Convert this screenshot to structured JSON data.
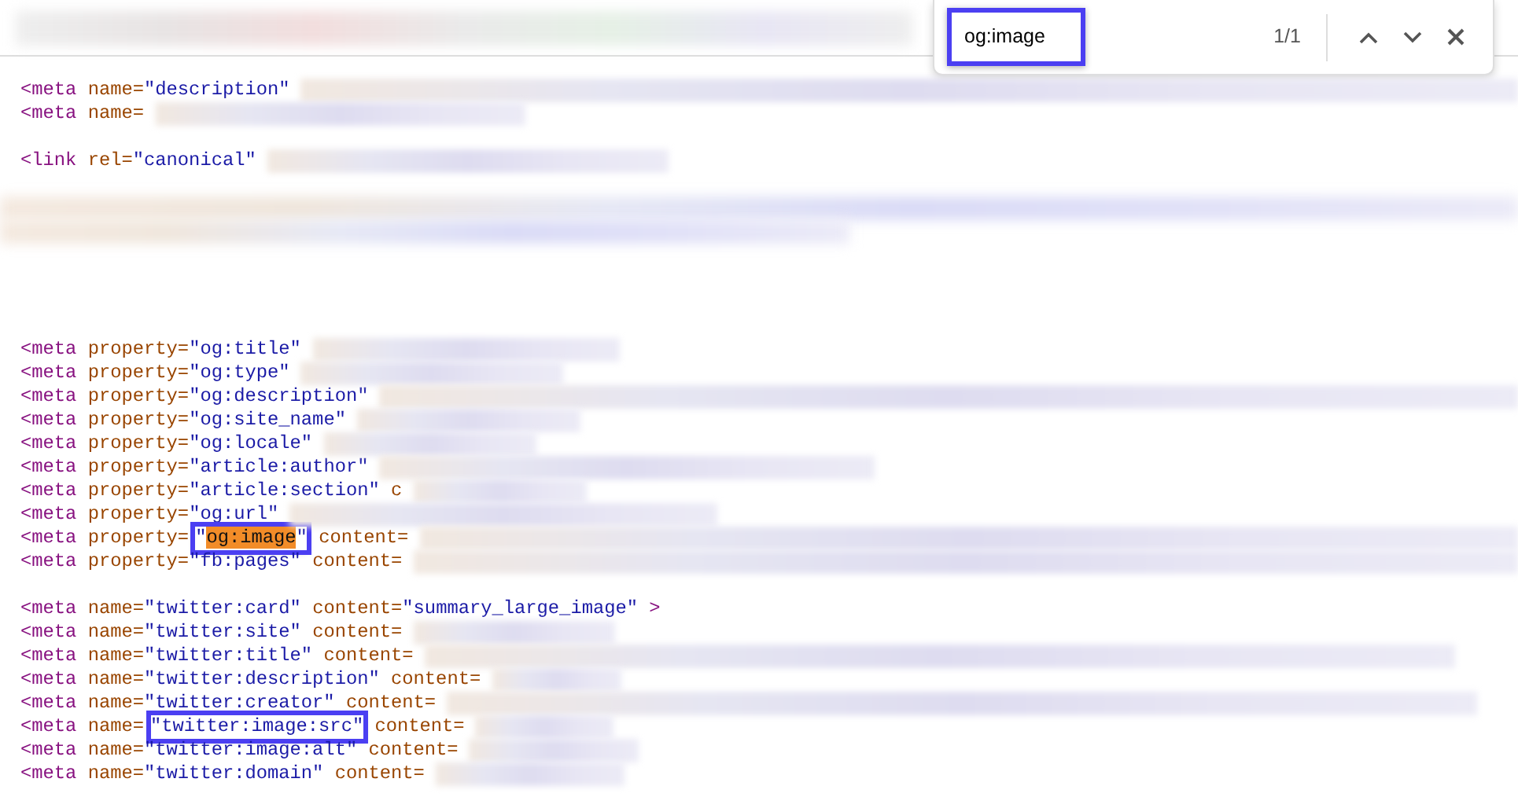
{
  "find_bar": {
    "query": "og:image",
    "outlined": true,
    "count": "1/1"
  },
  "lines": [
    {
      "kind": "code",
      "redacted": true,
      "tokens": [
        {
          "kind": "tag",
          "text": "<meta"
        },
        {
          "kind": "attr",
          "text": "name="
        },
        {
          "kind": "value",
          "text": "\"description\""
        }
      ]
    },
    {
      "kind": "code",
      "redacted": true,
      "tokens": [
        {
          "kind": "tag",
          "text": "<meta"
        },
        {
          "kind": "attr",
          "text": "name="
        }
      ]
    },
    {
      "kind": "blank"
    },
    {
      "kind": "code",
      "redacted": true,
      "tokens": [
        {
          "kind": "tag",
          "text": "<link"
        },
        {
          "kind": "attr",
          "text": "rel="
        },
        {
          "kind": "value",
          "text": "\"canonical\""
        }
      ]
    },
    {
      "kind": "blank"
    },
    {
      "kind": "redacted"
    },
    {
      "kind": "redacted"
    },
    {
      "kind": "blank"
    },
    {
      "kind": "blank"
    },
    {
      "kind": "blank"
    },
    {
      "kind": "blank"
    },
    {
      "kind": "code",
      "redacted": true,
      "tokens": [
        {
          "kind": "tag",
          "text": "<meta"
        },
        {
          "kind": "attr",
          "text": "property="
        },
        {
          "kind": "value",
          "text": "\"og:title\""
        }
      ]
    },
    {
      "kind": "code",
      "redacted": true,
      "tokens": [
        {
          "kind": "tag",
          "text": "<meta"
        },
        {
          "kind": "attr",
          "text": "property="
        },
        {
          "kind": "value",
          "text": "\"og:type\""
        }
      ]
    },
    {
      "kind": "code",
      "redacted": true,
      "tokens": [
        {
          "kind": "tag",
          "text": "<meta"
        },
        {
          "kind": "attr",
          "text": "property="
        },
        {
          "kind": "value",
          "text": "\"og:description\""
        }
      ]
    },
    {
      "kind": "code",
      "redacted": true,
      "tokens": [
        {
          "kind": "tag",
          "text": "<meta"
        },
        {
          "kind": "attr",
          "text": "property="
        },
        {
          "kind": "value",
          "text": "\"og:site_name\""
        }
      ]
    },
    {
      "kind": "code",
      "redacted": true,
      "tokens": [
        {
          "kind": "tag",
          "text": "<meta"
        },
        {
          "kind": "attr",
          "text": "property="
        },
        {
          "kind": "value",
          "text": "\"og:locale\""
        }
      ]
    },
    {
      "kind": "code",
      "redacted": true,
      "tokens": [
        {
          "kind": "tag",
          "text": "<meta"
        },
        {
          "kind": "attr",
          "text": "property="
        },
        {
          "kind": "value",
          "text": "\"article:author\""
        }
      ]
    },
    {
      "kind": "code",
      "redacted": true,
      "tokens": [
        {
          "kind": "tag",
          "text": "<meta"
        },
        {
          "kind": "attr",
          "text": "property="
        },
        {
          "kind": "value",
          "text": "\"article:section\""
        },
        {
          "kind": "attr",
          "text": "c"
        }
      ]
    },
    {
      "kind": "code",
      "redacted": true,
      "tokens": [
        {
          "kind": "tag",
          "text": "<meta"
        },
        {
          "kind": "attr",
          "text": "property="
        },
        {
          "kind": "value",
          "text": "\"og:url\""
        }
      ]
    },
    {
      "kind": "code",
      "redacted": true,
      "tokens": [
        {
          "kind": "tag",
          "text": "<meta"
        },
        {
          "kind": "attr",
          "text": "property="
        },
        {
          "kind": "value",
          "outlined": true,
          "parts": [
            {
              "text": "\"",
              "highlighted": false
            },
            {
              "text": "og:image",
              "highlighted": true
            },
            {
              "text": "\"",
              "highlighted": false
            }
          ]
        },
        {
          "kind": "attr",
          "text": "content="
        }
      ]
    },
    {
      "kind": "code",
      "redacted": true,
      "tokens": [
        {
          "kind": "tag",
          "text": "<meta"
        },
        {
          "kind": "attr",
          "text": "property="
        },
        {
          "kind": "value",
          "text": "\"fb:pages\""
        },
        {
          "kind": "attr",
          "text": "content="
        }
      ]
    },
    {
      "kind": "blank"
    },
    {
      "kind": "code",
      "redacted": false,
      "tokens": [
        {
          "kind": "tag",
          "text": "<meta"
        },
        {
          "kind": "attr",
          "text": "name="
        },
        {
          "kind": "value",
          "text": "\"twitter:card\""
        },
        {
          "kind": "attr",
          "text": "content="
        },
        {
          "kind": "value",
          "text": "\"summary_large_image\""
        },
        {
          "kind": "tag",
          "text": ">"
        }
      ]
    },
    {
      "kind": "code",
      "redacted": true,
      "tokens": [
        {
          "kind": "tag",
          "text": "<meta"
        },
        {
          "kind": "attr",
          "text": "name="
        },
        {
          "kind": "value",
          "text": "\"twitter:site\""
        },
        {
          "kind": "attr",
          "text": "content="
        }
      ]
    },
    {
      "kind": "code",
      "redacted": true,
      "tokens": [
        {
          "kind": "tag",
          "text": "<meta"
        },
        {
          "kind": "attr",
          "text": "name="
        },
        {
          "kind": "value",
          "text": "\"twitter:title\""
        },
        {
          "kind": "attr",
          "text": "content="
        }
      ]
    },
    {
      "kind": "code",
      "redacted": true,
      "tokens": [
        {
          "kind": "tag",
          "text": "<meta"
        },
        {
          "kind": "attr",
          "text": "name="
        },
        {
          "kind": "value",
          "text": "\"twitter:description\""
        },
        {
          "kind": "attr",
          "text": "content="
        }
      ]
    },
    {
      "kind": "code",
      "redacted": true,
      "tokens": [
        {
          "kind": "tag",
          "text": "<meta"
        },
        {
          "kind": "attr",
          "text": "name="
        },
        {
          "kind": "value",
          "text": "\"twitter:creator\""
        },
        {
          "kind": "attr",
          "text": "content="
        }
      ]
    },
    {
      "kind": "code",
      "redacted": true,
      "tokens": [
        {
          "kind": "tag",
          "text": "<meta"
        },
        {
          "kind": "attr",
          "text": "name="
        },
        {
          "kind": "value",
          "outlined": true,
          "text": "\"twitter:image:src\""
        },
        {
          "kind": "attr",
          "text": "content="
        }
      ]
    },
    {
      "kind": "code",
      "redacted": true,
      "tokens": [
        {
          "kind": "tag",
          "text": "<meta"
        },
        {
          "kind": "attr",
          "text": "name="
        },
        {
          "kind": "value",
          "text": "\"twitter:image:alt\""
        },
        {
          "kind": "attr",
          "text": "content="
        }
      ]
    },
    {
      "kind": "code",
      "redacted": true,
      "tokens": [
        {
          "kind": "tag",
          "text": "<meta"
        },
        {
          "kind": "attr",
          "text": "name="
        },
        {
          "kind": "value",
          "text": "\"twitter:domain\""
        },
        {
          "kind": "attr",
          "text": "content="
        }
      ]
    }
  ]
}
